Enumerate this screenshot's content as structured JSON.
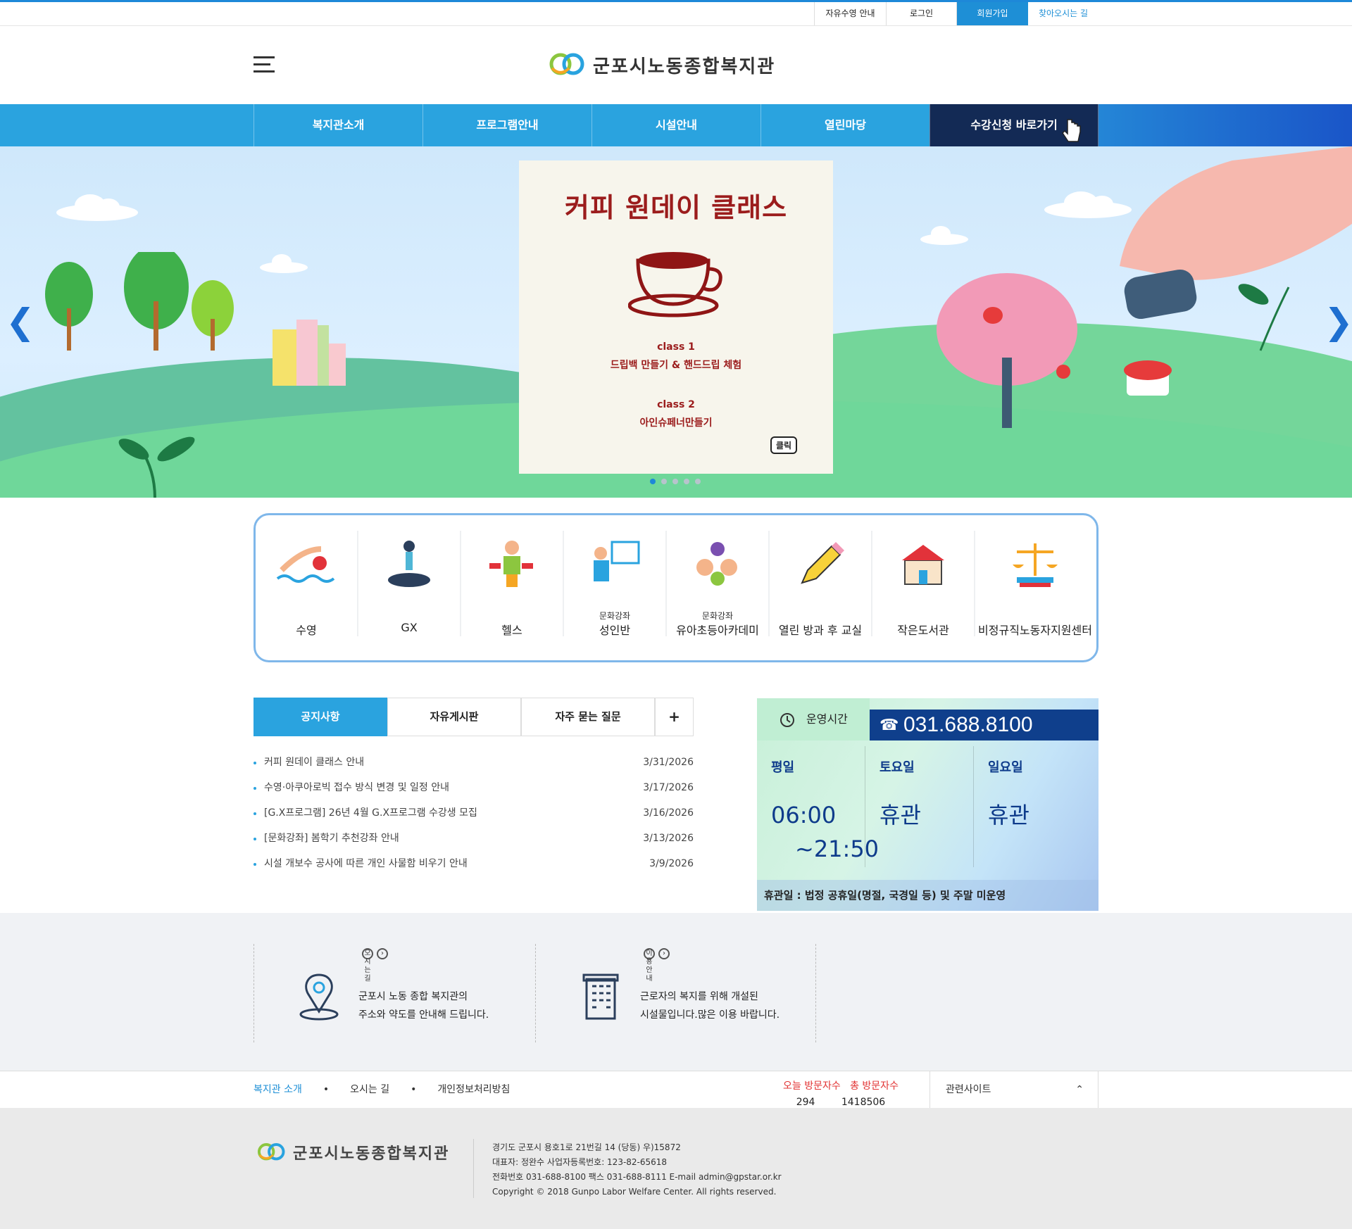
{
  "utility": {
    "links": [
      "자유수영 안내",
      "로그인",
      "회원가입",
      "찾아오시는 길"
    ]
  },
  "brand": {
    "name": "군포시노동종합복지관"
  },
  "gnb": {
    "items": [
      "복지관소개",
      "프로그램안내",
      "시설안내",
      "열린마당",
      "수강신청 바로가기"
    ]
  },
  "hero": {
    "title": "커피 원데이 클래스",
    "class1": "class 1",
    "class1_desc": "드립백 만들기 & 핸드드립 체험",
    "class2": "class 2",
    "class2_desc": "아인슈페너만들기",
    "click": "클릭"
  },
  "quick": {
    "items": [
      {
        "sub": "",
        "label": "수영"
      },
      {
        "sub": "",
        "label": "GX"
      },
      {
        "sub": "",
        "label": "헬스"
      },
      {
        "sub": "문화강좌",
        "label": "성인반"
      },
      {
        "sub": "문화강좌",
        "label": "유아초등아카데미"
      },
      {
        "sub": "",
        "label": "열린 방과 후 교실"
      },
      {
        "sub": "",
        "label": "작은도서관"
      },
      {
        "sub": "",
        "label": "비정규직노동자지원센터"
      }
    ]
  },
  "board": {
    "tabs": [
      "공지사항",
      "자유게시판",
      "자주 묻는 질문",
      "+"
    ],
    "rows": [
      {
        "title": "커피 원데이 클래스 안내",
        "date": "3/31/2026"
      },
      {
        "title": "수영·아쿠아로빅 접수 방식 변경 및 일정 안내",
        "date": "3/17/2026"
      },
      {
        "title": "[G.X프로그램] 26년 4월 G.X프로그램 수강생 모집",
        "date": "3/16/2026"
      },
      {
        "title": "[문화강좌] 봄학기 추천강좌 안내",
        "date": "3/13/2026"
      },
      {
        "title": "시설 개보수 공사에 따른 개인 사물함 비우기 안내",
        "date": "3/9/2026"
      }
    ]
  },
  "ops": {
    "tab": "운영시간",
    "tel": "031.688.8100",
    "cols": [
      {
        "day": "평일",
        "hours": "06:00",
        "hours2": "~21:50"
      },
      {
        "day": "토요일",
        "hours": "휴관"
      },
      {
        "day": "일요일",
        "hours": "휴관"
      }
    ],
    "closed": "휴관일 : 법정 공휴일(명절, 국경일 등) 및 주말 미운영"
  },
  "guide": [
    {
      "title": "오시는 길",
      "line1": "군포시 노동 종합 복지관의",
      "line2": "주소와 약도를 안내해 드립니다."
    },
    {
      "title": "이용안내",
      "line1": "근로자의 복지를 위해 개설된",
      "line2": "시설물입니다.많은 이용 바랍니다."
    }
  ],
  "fnav": {
    "links": [
      "복지관 소개",
      "•",
      "오시는 길",
      "•",
      "개인정보처리방침"
    ],
    "today_label": "오늘 방문자수",
    "total_label": "총 방문자수",
    "today": "294",
    "total": "1418506",
    "related": "관련사이트"
  },
  "footer": {
    "addr": "경기도 군포시 용호1로 21번길 14 (당동)     우)15872",
    "rep": "대표자: 정완수     사업자등록번호: 123-82-65618",
    "tel": "전화번호 031-688-8100     팩스 031-688-8111     E-mail admin@gpstar.or.kr",
    "copy": "Copyright © 2018 Gunpo Labor Welfare Center. All rights reserved."
  }
}
